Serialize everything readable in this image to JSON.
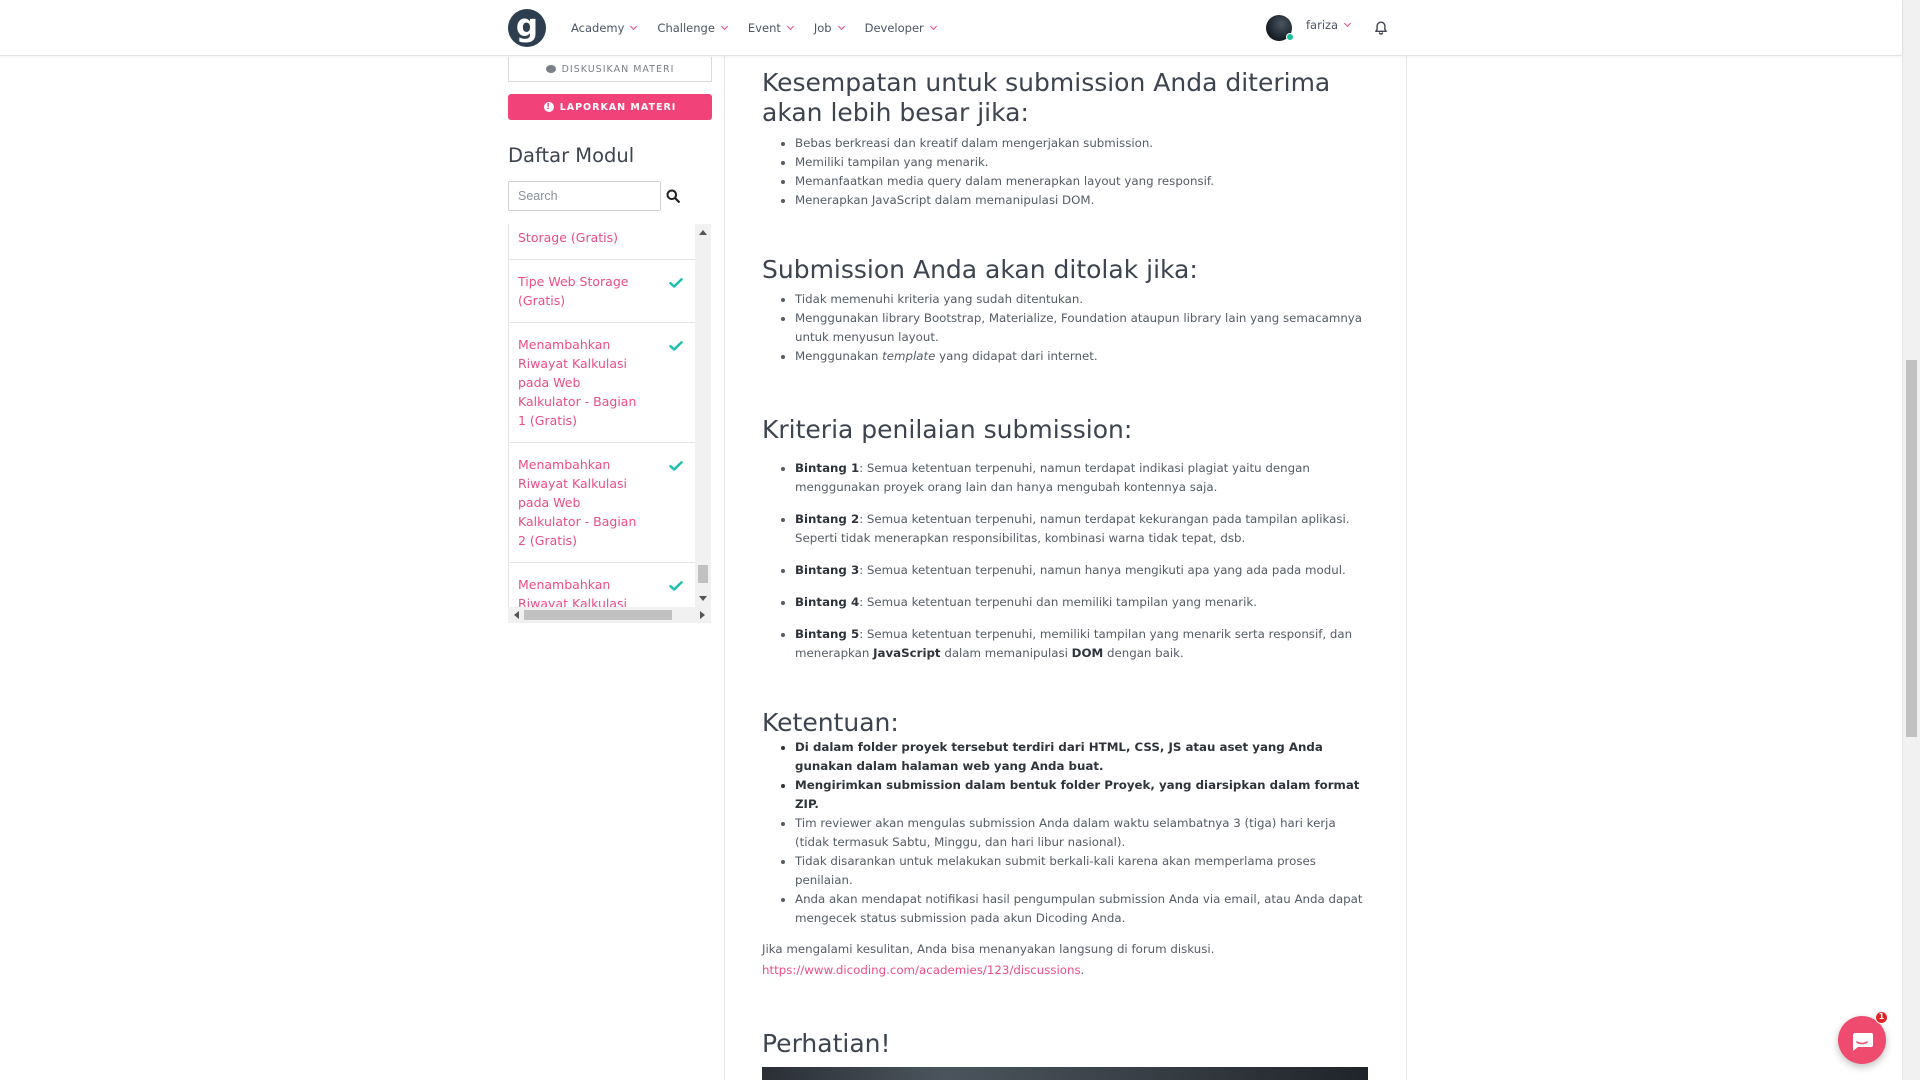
{
  "navbar": {
    "logo_letter": "g",
    "menu": [
      {
        "label": "Academy"
      },
      {
        "label": "Challenge"
      },
      {
        "label": "Event"
      },
      {
        "label": "Job"
      },
      {
        "label": "Developer"
      }
    ],
    "user": {
      "name": "fariza"
    }
  },
  "sidebar": {
    "discuss_label": "DISKUSIKAN MATERI",
    "report_label": "LAPORKAN MATERI",
    "title": "Daftar Modul",
    "search_placeholder": "Search",
    "modules": [
      {
        "label": "Storage (Gratis)",
        "completed": false
      },
      {
        "label": "Tipe Web Storage (Gratis)",
        "completed": true
      },
      {
        "label": "Menambahkan Riwayat Kalkulasi pada Web Kalkulator - Bagian 1 (Gratis)",
        "completed": true
      },
      {
        "label": "Menambahkan Riwayat Kalkulasi pada Web Kalkulator - Bagian 2 (Gratis)",
        "completed": true
      },
      {
        "label": "Menambahkan Riwayat Kalkulasi pada Web",
        "completed": true
      }
    ]
  },
  "content": {
    "section1": {
      "heading": "Kesempatan untuk submission Anda diterima akan lebih besar jika:",
      "items": [
        "Bebas berkreasi dan kreatif dalam mengerjakan submission.",
        "Memiliki tampilan yang menarik.",
        "Memanfaatkan media query dalam menerapkan layout yang responsif.",
        "Menerapkan JavaScript dalam memanipulasi DOM."
      ]
    },
    "section2": {
      "heading": "Submission Anda akan ditolak jika:",
      "items": [
        "Tidak memenuhi kriteria yang sudah ditentukan.",
        "Menggunakan library Bootstrap, Materialize, Foundation ataupun library lain yang semacamnya untuk menyusun layout."
      ],
      "item3_prefix": "Menggunakan ",
      "item3_em": "template",
      "item3_suffix": " yang didapat dari internet."
    },
    "section3": {
      "heading": "Kriteria penilaian submission:",
      "items": [
        {
          "label": "Bintang 1",
          "text": ": Semua ketentuan terpenuhi, namun terdapat indikasi plagiat yaitu dengan menggunakan proyek orang lain dan hanya mengubah kontennya saja."
        },
        {
          "label": "Bintang 2",
          "text": ": Semua ketentuan terpenuhi, namun terdapat kekurangan pada tampilan aplikasi. Seperti tidak menerapkan responsibilitas, kombinasi warna tidak tepat, dsb."
        },
        {
          "label": "Bintang 3",
          "text": ": Semua ketentuan terpenuhi, namun hanya mengikuti apa yang ada pada modul."
        },
        {
          "label": "Bintang 4",
          "text": ": Semua ketentuan terpenuhi dan memiliki tampilan yang menarik."
        }
      ],
      "item5": {
        "label": "Bintang 5",
        "text1": ": Semua ketentuan terpenuhi, memiliki tampilan yang menarik serta responsif, dan menerapkan ",
        "b1": "JavaScript",
        "text2": " dalam memanipulasi ",
        "b2": "DOM",
        "text3": " dengan baik."
      }
    },
    "section4": {
      "heading": "Ketentuan:",
      "bold_items": [
        "Di dalam folder proyek tersebut terdiri dari HTML, CSS, JS atau aset yang Anda gunakan dalam halaman web yang Anda buat.",
        "Mengirimkan submission dalam bentuk folder Proyek, yang diarsipkan dalam format ZIP."
      ],
      "items": [
        "Tim reviewer akan mengulas submission Anda dalam waktu selambatnya 3 (tiga) hari kerja (tidak termasuk Sabtu, Minggu, dan hari libur nasional).",
        "Tidak disarankan untuk melakukan submit berkali-kali karena akan memperlama proses penilaian.",
        "Anda akan mendapat notifikasi hasil pengumpulan submission Anda via email, atau Anda dapat mengecek status submission pada akun Dicoding Anda."
      ],
      "note": "Jika mengalami kesulitan, Anda bisa menanyakan langsung di forum diskusi.",
      "link": "https://www.dicoding.com/academies/123/discussions",
      "link_suffix": "."
    },
    "section5": {
      "heading": "Perhatian!"
    }
  },
  "chat": {
    "badge_count": "1"
  },
  "colors": {
    "accent": "#ec4d87",
    "report_button": "#f2427a",
    "check": "#18c1b1",
    "logo_bg": "#2d3e50",
    "chat": "#ef4b6f"
  }
}
